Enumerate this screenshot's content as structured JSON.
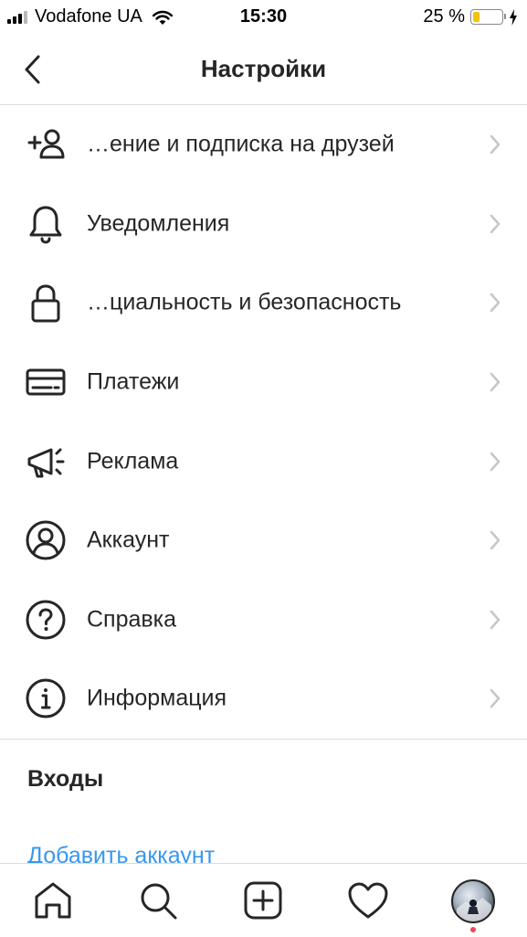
{
  "status_bar": {
    "carrier": "Vodafone UA",
    "time": "15:30",
    "battery_percent": "25 %",
    "battery_level": 0.25
  },
  "header": {
    "title": "Настройки",
    "back_icon": "chevron-left-icon"
  },
  "menu": [
    {
      "label": "…ение и подписка на друзей",
      "icon": "add-person-icon"
    },
    {
      "label": "Уведомления",
      "icon": "bell-icon"
    },
    {
      "label": "…циальность и безопасность",
      "icon": "lock-icon"
    },
    {
      "label": "Платежи",
      "icon": "credit-card-icon"
    },
    {
      "label": "Реклама",
      "icon": "megaphone-icon"
    },
    {
      "label": "Аккаунт",
      "icon": "account-circle-icon"
    },
    {
      "label": "Справка",
      "icon": "help-circle-icon"
    },
    {
      "label": "Информация",
      "icon": "info-circle-icon"
    }
  ],
  "logins_section": {
    "title": "Входы",
    "add_account": "Добавить аккаунт"
  },
  "tabbar": {
    "items": [
      "home-icon",
      "search-icon",
      "add-post-icon",
      "heart-icon",
      "profile-avatar"
    ],
    "notification_dot_color": "#ed4956"
  },
  "colors": {
    "text": "#262626",
    "link": "#3897f0",
    "chevron": "#c7c7c7",
    "divider": "#dbdbdb"
  }
}
